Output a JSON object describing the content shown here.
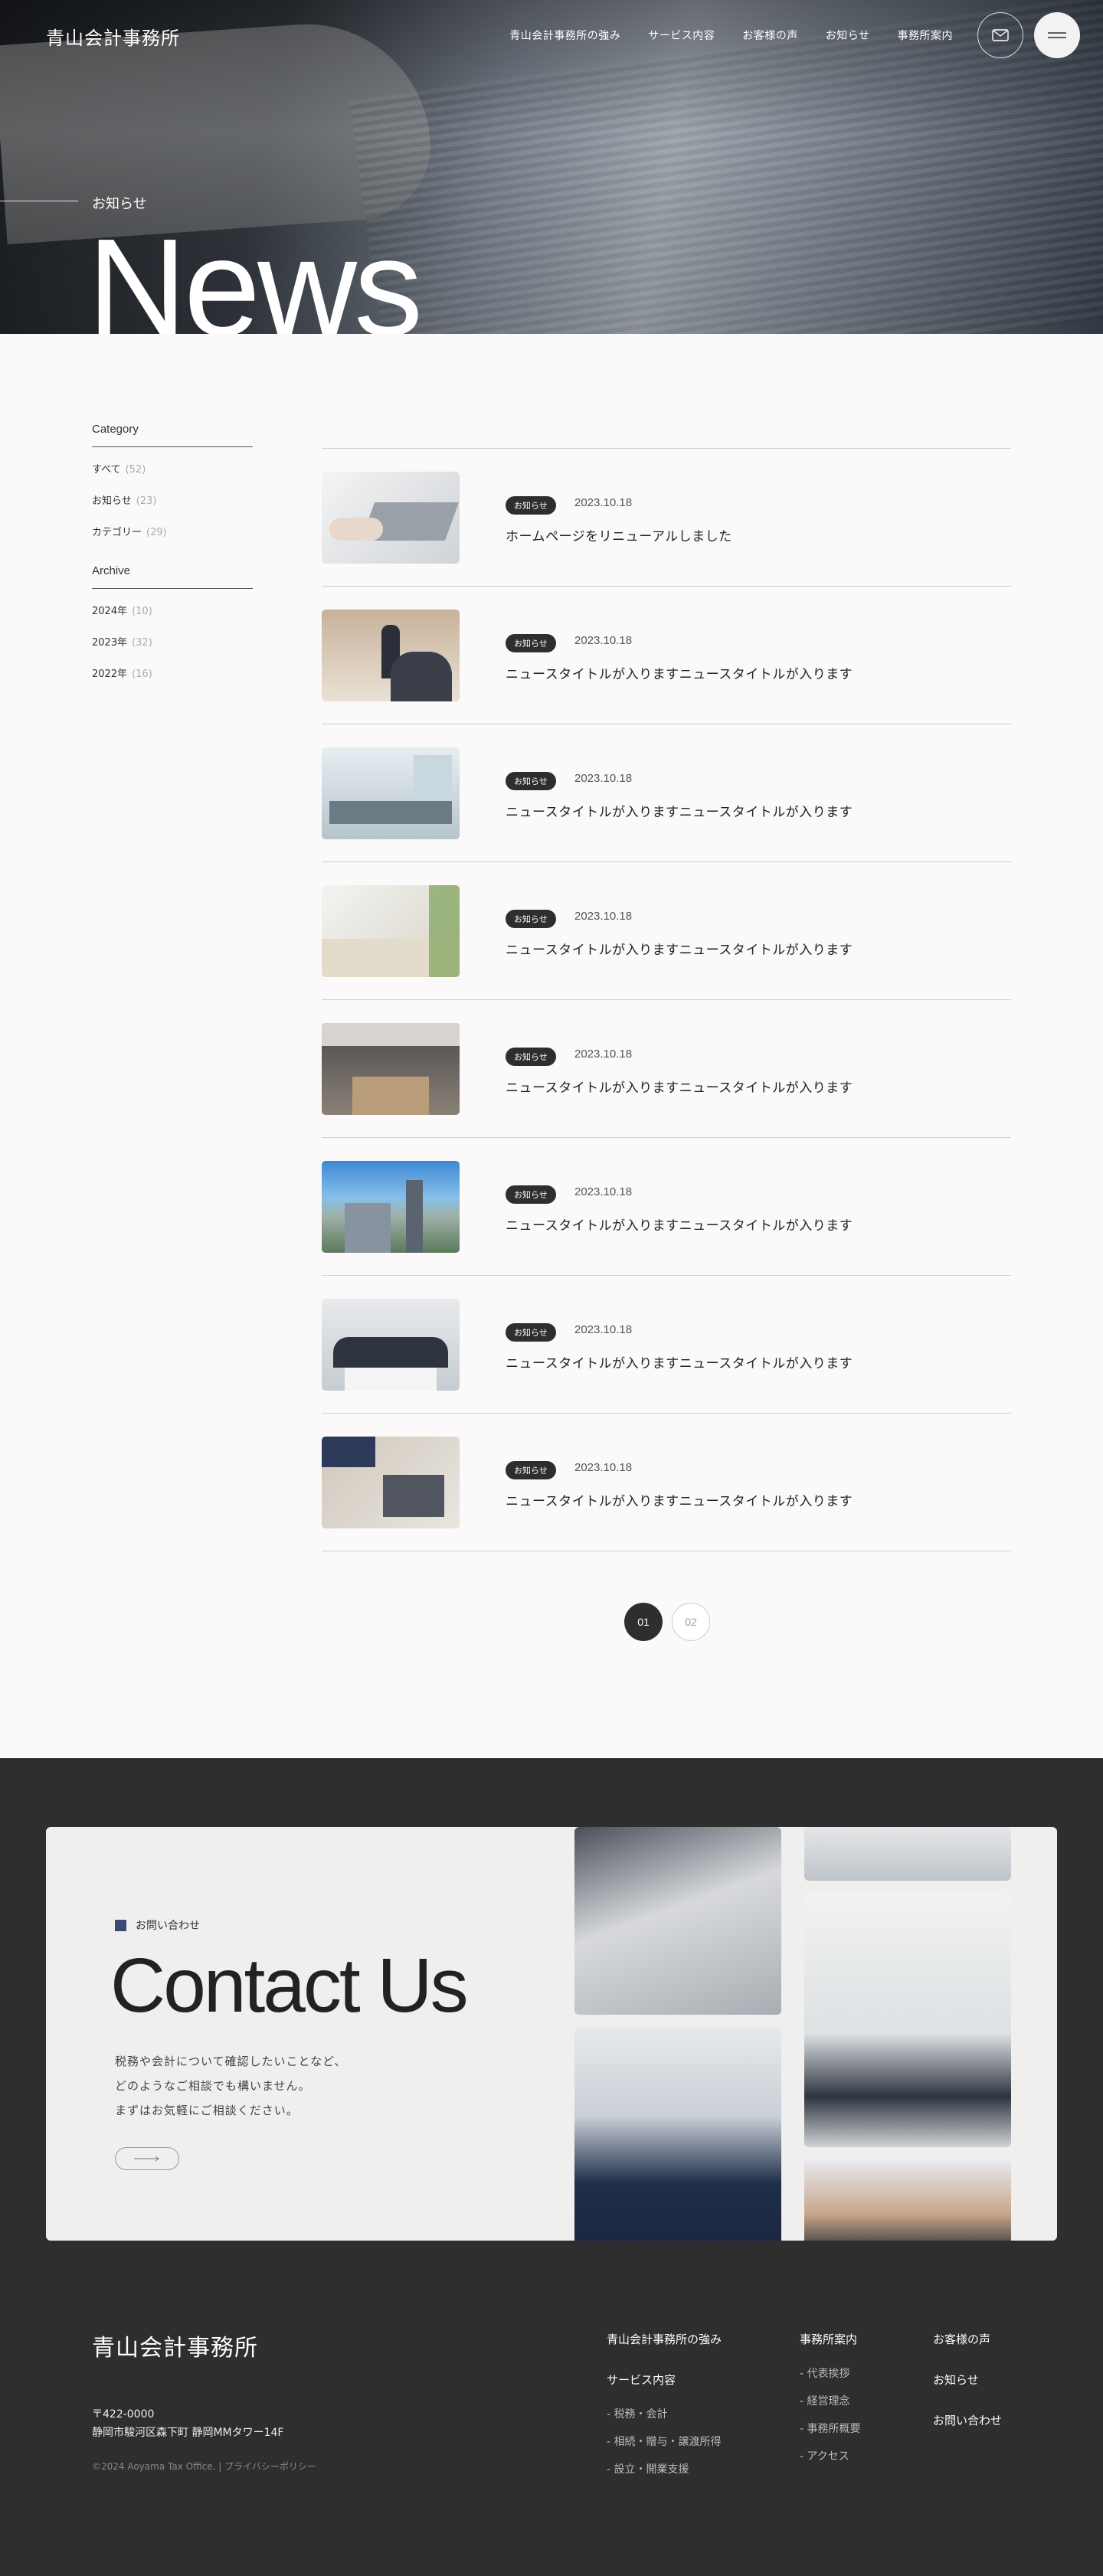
{
  "header": {
    "logo": "青山会計事務所",
    "nav": [
      "青山会計事務所の強み",
      "サービス内容",
      "お客様の声",
      "お知らせ",
      "事務所案内"
    ],
    "mail_icon": "mail-icon",
    "menu_icon": "menu-icon"
  },
  "hero": {
    "subtitle": "お知らせ",
    "title": "News"
  },
  "sidebar": {
    "category_heading": "Category",
    "categories": [
      {
        "label": "すべて",
        "count": "(52)"
      },
      {
        "label": "お知らせ",
        "count": "(23)"
      },
      {
        "label": "カテゴリー",
        "count": "(29)"
      }
    ],
    "archive_heading": "Archive",
    "archives": [
      {
        "label": "2024年",
        "count": "(10)"
      },
      {
        "label": "2023年",
        "count": "(32)"
      },
      {
        "label": "2022年",
        "count": "(16)"
      }
    ]
  },
  "news": [
    {
      "badge": "お知らせ",
      "date": "2023.10.18",
      "title": "ホームページをリニューアルしました"
    },
    {
      "badge": "お知らせ",
      "date": "2023.10.18",
      "title": "ニュースタイトルが入りますニュースタイトルが入ります"
    },
    {
      "badge": "お知らせ",
      "date": "2023.10.18",
      "title": "ニュースタイトルが入りますニュースタイトルが入ります"
    },
    {
      "badge": "お知らせ",
      "date": "2023.10.18",
      "title": "ニュースタイトルが入りますニュースタイトルが入ります"
    },
    {
      "badge": "お知らせ",
      "date": "2023.10.18",
      "title": "ニュースタイトルが入りますニュースタイトルが入ります"
    },
    {
      "badge": "お知らせ",
      "date": "2023.10.18",
      "title": "ニュースタイトルが入りますニュースタイトルが入ります"
    },
    {
      "badge": "お知らせ",
      "date": "2023.10.18",
      "title": "ニュースタイトルが入りますニュースタイトルが入ります"
    },
    {
      "badge": "お知らせ",
      "date": "2023.10.18",
      "title": "ニュースタイトルが入りますニュースタイトルが入ります"
    }
  ],
  "pagination": {
    "pages": [
      "01",
      "02"
    ],
    "current": "01"
  },
  "contact": {
    "label": "お問い合わせ",
    "title": "Contact Us",
    "text": [
      "税務や会計について確認したいことなど、",
      "どのようなご相談でも構いません。",
      "まずはお気軽にご相談ください。"
    ],
    "button_icon": "arrow-right-icon",
    "accent_color": "#3a4b78"
  },
  "footer": {
    "logo": "青山会計事務所",
    "postal": "〒422-0000",
    "address": "静岡市駿河区森下町 静岡MMタワー14F",
    "copyright": "©2024 Aoyama Tax Office. | プライバシーポリシー",
    "col1": {
      "link1": "青山会計事務所の強み",
      "heading": "サービス内容",
      "items": [
        "- 税務・会計",
        "- 相続・贈与・譲渡所得",
        "- 設立・開業支援"
      ]
    },
    "col2": {
      "heading": "事務所案内",
      "items": [
        "- 代表挨拶",
        "- 経営理念",
        "- 事務所概要",
        "- アクセス"
      ]
    },
    "col3": [
      "お客様の声",
      "お知らせ",
      "お問い合わせ"
    ]
  }
}
